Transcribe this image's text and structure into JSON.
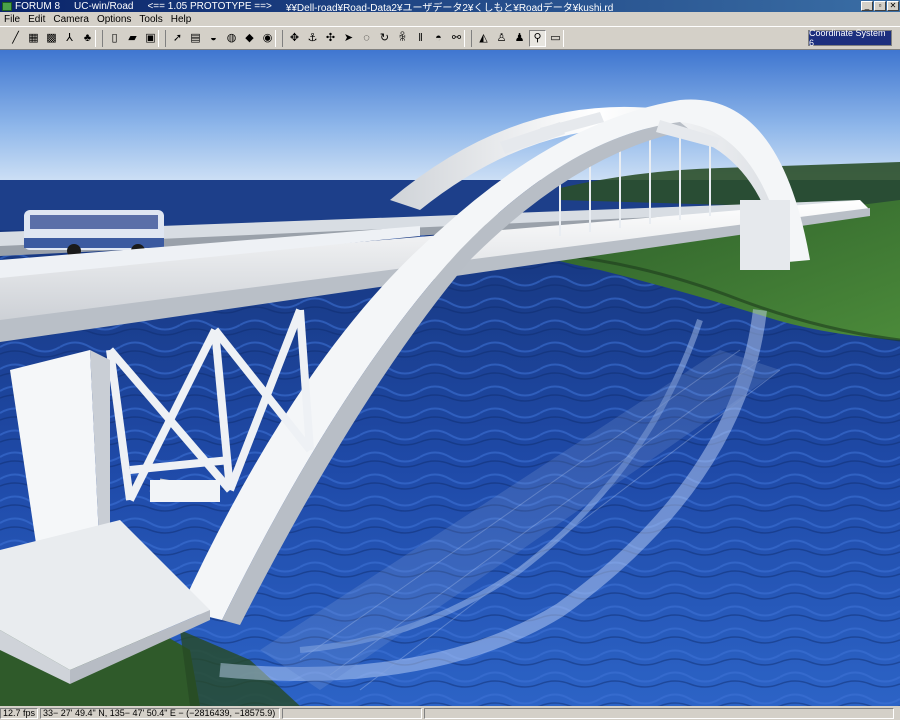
{
  "titlebar": {
    "app": "FORUM 8",
    "product": "UC-win/Road",
    "version": "<== 1.05 PROTOTYPE ==>",
    "path": "¥¥Dell-road¥Road-Data2¥ユーザデータ2¥くしもと¥Roadデータ¥kushi.rd"
  },
  "menu": [
    "File",
    "Edit",
    "Camera",
    "Options",
    "Tools",
    "Help"
  ],
  "toolbar": {
    "groups": [
      [
        {
          "icon": "road-icon",
          "glyph": "╱"
        },
        {
          "icon": "map-grid-icon",
          "glyph": "▦"
        },
        {
          "icon": "terrain-grid-icon",
          "glyph": "▩"
        },
        {
          "icon": "figure-icon",
          "glyph": "⅄"
        },
        {
          "icon": "tree-icon",
          "glyph": "♣"
        }
      ],
      [
        {
          "icon": "new-file-icon",
          "glyph": "▯"
        },
        {
          "icon": "open-folder-icon",
          "glyph": "▰"
        },
        {
          "icon": "save-icon",
          "glyph": "▣"
        }
      ],
      [
        {
          "icon": "pointer-icon",
          "glyph": "➚"
        },
        {
          "icon": "scenery-icon",
          "glyph": "▤"
        },
        {
          "icon": "model-icon",
          "glyph": "◒"
        },
        {
          "icon": "texture-icon",
          "glyph": "◍"
        },
        {
          "icon": "landscape-icon",
          "glyph": "◆"
        },
        {
          "icon": "car-icon",
          "glyph": "◉"
        }
      ],
      [
        {
          "icon": "rotate-icon",
          "glyph": "✥"
        },
        {
          "icon": "anchor-icon",
          "glyph": "⚓"
        },
        {
          "icon": "move-icon",
          "glyph": "✣"
        },
        {
          "icon": "drive-icon",
          "glyph": "➤"
        },
        {
          "icon": "fog-icon",
          "glyph": "◌"
        },
        {
          "icon": "refresh-icon",
          "glyph": "↻"
        },
        {
          "icon": "person-icon",
          "glyph": "ꆜ"
        },
        {
          "icon": "pause-icon",
          "glyph": "‖"
        },
        {
          "icon": "vehicle-icon",
          "glyph": "◓"
        },
        {
          "icon": "link-icon",
          "glyph": "⚯"
        }
      ],
      [
        {
          "icon": "road-view-icon",
          "glyph": "◭"
        },
        {
          "icon": "walker-icon",
          "glyph": "♙"
        },
        {
          "icon": "standing-person-icon",
          "glyph": "♟"
        },
        {
          "icon": "walking-person-icon",
          "glyph": "⚲"
        },
        {
          "icon": "panel-icon",
          "glyph": "▭"
        }
      ]
    ],
    "coordinate_label": "Coordinate System 6"
  },
  "statusbar": {
    "fps": "12.7 fps",
    "position": "33− 27' 49.4\" N, 135− 47' 50.4\" E  −  (−2816439, −18575.9)",
    "cell3": "",
    "cell4": ""
  }
}
